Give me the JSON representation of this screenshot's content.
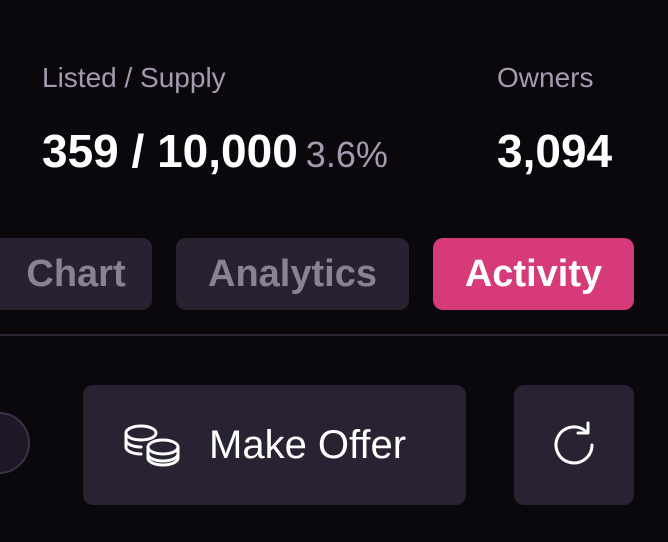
{
  "stats": {
    "listed_supply": {
      "label": "Listed / Supply",
      "value": "359 / 10,000",
      "percent": "3.6%"
    },
    "owners": {
      "label": "Owners",
      "value": "3,094"
    }
  },
  "tabs": [
    {
      "label": "Chart",
      "active": false
    },
    {
      "label": "Analytics",
      "active": false
    },
    {
      "label": "Activity",
      "active": true
    }
  ],
  "actions": {
    "make_offer_label": "Make Offer",
    "make_offer_icon": "coins-icon",
    "refresh_icon": "refresh-icon",
    "partial_button_icon": "circle-icon"
  },
  "colors": {
    "background": "#0a080d",
    "accent": "#d63a79",
    "muted_text": "#a49bb1",
    "button_bg": "#292233"
  }
}
